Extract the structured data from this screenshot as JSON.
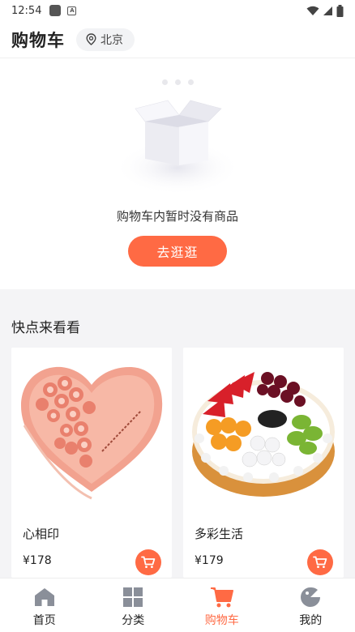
{
  "status_bar": {
    "time": "12:54"
  },
  "header": {
    "title": "购物车",
    "location": "北京"
  },
  "empty_cart": {
    "message": "购物车内暂时没有商品",
    "button_label": "去逛逛"
  },
  "recommend": {
    "title": "快点来看看",
    "products": [
      {
        "name": "心相印",
        "price": "¥178"
      },
      {
        "name": "多彩生活",
        "price": "¥179"
      }
    ]
  },
  "tabbar": {
    "tabs": [
      {
        "label": "首页",
        "icon": "home-icon"
      },
      {
        "label": "分类",
        "icon": "grid-icon"
      },
      {
        "label": "购物车",
        "icon": "cart-icon"
      },
      {
        "label": "我的",
        "icon": "profile-icon"
      }
    ],
    "active": "购物车"
  },
  "colors": {
    "accent": "#ff6a44",
    "background": "#f4f4f6"
  }
}
